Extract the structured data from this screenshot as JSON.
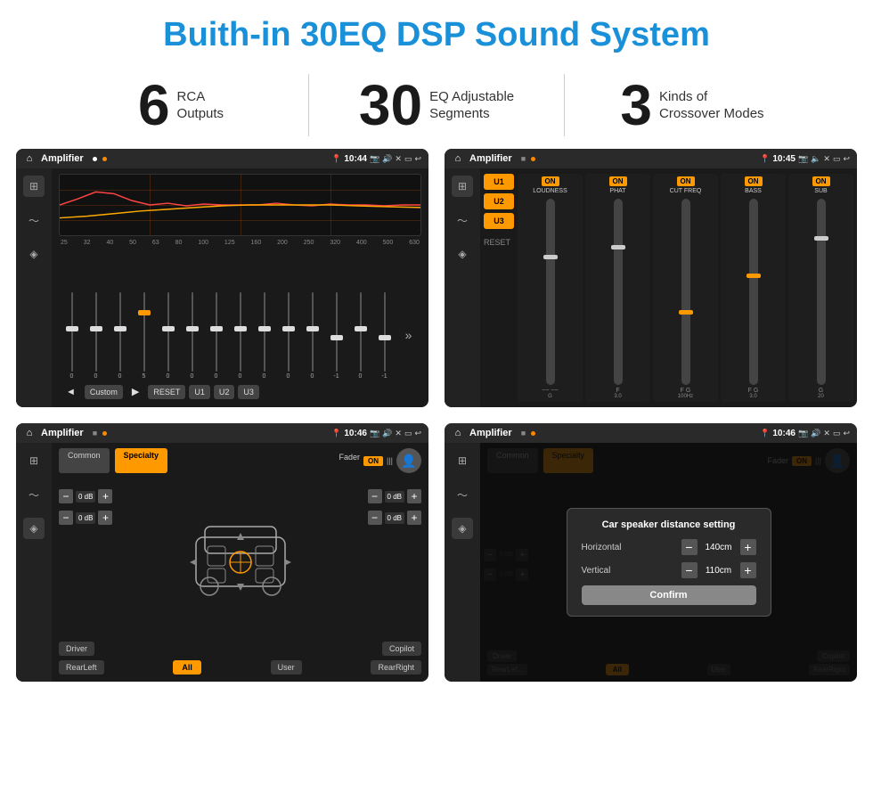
{
  "page": {
    "title": "Buith-in 30EQ DSP Sound System",
    "stats": [
      {
        "number": "6",
        "label": "RCA\nOutputs"
      },
      {
        "number": "30",
        "label": "EQ Adjustable\nSegments"
      },
      {
        "number": "3",
        "label": "Kinds of\nCrossover Modes"
      }
    ]
  },
  "screens": {
    "s1": {
      "title": "Amplifier",
      "time": "10:44",
      "freq_labels": [
        "25",
        "32",
        "40",
        "50",
        "63",
        "80",
        "100",
        "125",
        "160",
        "200",
        "250",
        "320",
        "400",
        "500",
        "630"
      ],
      "slider_values": [
        "0",
        "0",
        "0",
        "5",
        "0",
        "0",
        "0",
        "0",
        "0",
        "0",
        "0",
        "-1",
        "0",
        "-1"
      ],
      "bottom_btns": [
        "Custom",
        "RESET",
        "U1",
        "U2",
        "U3"
      ]
    },
    "s2": {
      "title": "Amplifier",
      "time": "10:45",
      "presets": [
        "U1",
        "U2",
        "U3"
      ],
      "channels": [
        {
          "on": true,
          "name": "LOUDNESS"
        },
        {
          "on": true,
          "name": "PHAT"
        },
        {
          "on": true,
          "name": "CUT FREQ"
        },
        {
          "on": true,
          "name": "BASS"
        },
        {
          "on": true,
          "name": "SUB"
        }
      ]
    },
    "s3": {
      "title": "Amplifier",
      "time": "10:46",
      "tabs": [
        "Common",
        "Specialty"
      ],
      "fader_label": "Fader",
      "controls": [
        {
          "label": "0 dB"
        },
        {
          "label": "0 dB"
        },
        {
          "label": "0 dB"
        },
        {
          "label": "0 dB"
        }
      ],
      "bottom_btns": [
        "Driver",
        "RearLeft",
        "All",
        "User",
        "RearRight",
        "Copilot"
      ]
    },
    "s4": {
      "title": "Amplifier",
      "time": "10:46",
      "tabs": [
        "Common",
        "Specialty"
      ],
      "dialog": {
        "title": "Car speaker distance setting",
        "horizontal_label": "Horizontal",
        "horizontal_value": "140cm",
        "vertical_label": "Vertical",
        "vertical_value": "110cm",
        "confirm_label": "Confirm",
        "db_values": [
          "0 dB",
          "0 dB"
        ]
      },
      "bottom_btns": [
        "Driver",
        "RearLef...",
        "All",
        "User",
        "RearRight",
        "Copilot"
      ]
    }
  },
  "icons": {
    "home": "⌂",
    "play": "▶",
    "back": "◄",
    "forward": "▶",
    "skip": "»",
    "eq": "≡",
    "wave": "〜",
    "speaker": "🔊",
    "pin": "📍",
    "camera": "📷",
    "volume": "🔊",
    "minus": "−",
    "plus": "+"
  }
}
